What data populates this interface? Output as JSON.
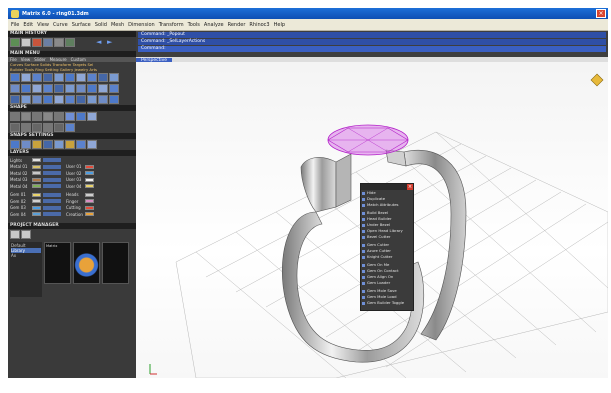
{
  "window": {
    "title": "Matrix 6.0 - ring01.3dm"
  },
  "menu": [
    "File",
    "Edit",
    "View",
    "Curve",
    "Surface",
    "Solid",
    "Mesh",
    "Dimension",
    "Transform",
    "Tools",
    "Analyze",
    "Render",
    "Rhinoc3",
    "Help"
  ],
  "left_panel": {
    "main_history": "MAIN HISTORY",
    "main_menu": "MAIN MENU",
    "main_menu_tabs": [
      "File",
      "View",
      "Slider",
      "Measure",
      "Custom"
    ],
    "builder_row": "Curves Surface Solids Transform Targets Sel",
    "builder_row2": "Builder Tools Ring Setting Gallery Jewelry Arts",
    "shape": "SHAPE",
    "snaps": "SNAPS SETTINGS",
    "layers": "LAYERS",
    "layer_rows": [
      {
        "name": "Lights",
        "right": ""
      },
      {
        "name": "Metal 01",
        "right": "User 01"
      },
      {
        "name": "Metal 02",
        "right": "User 02"
      },
      {
        "name": "Metal 03",
        "right": "User 03"
      },
      {
        "name": "Metal 04",
        "right": "User 04"
      },
      {
        "name": "Gem 01",
        "right": "Heads"
      },
      {
        "name": "Gem 02",
        "right": "Finger"
      },
      {
        "name": "Gem 03",
        "right": "Cutting"
      },
      {
        "name": "Gem 04",
        "right": "Creation"
      }
    ],
    "project_manager": "PROJECT MANAGER",
    "pm_tree": [
      "Default",
      "Library",
      "Ax"
    ],
    "thumb_label": "Matrix"
  },
  "command": {
    "line1": "Command: _Popout",
    "line2": "Command: _SelLayerActions",
    "line3": "Command:"
  },
  "viewport": {
    "label": "Perspective"
  },
  "popup_menu": {
    "groups": [
      [
        "Hide",
        "Duplicate",
        "Match Attributes"
      ],
      [
        "Build Bezel",
        "Head Builder",
        "Under Bezel",
        "Open Head Library",
        "Bezel Cutter"
      ],
      [
        "Gem Cutter",
        "Azure Cutter",
        "Knight Cutter"
      ],
      [
        "Gem On Me",
        "Gem On Contact",
        "Gem Align On",
        "Gem Loader"
      ],
      [
        "Gem Mole Save",
        "Gem Mole Load",
        "Gem Builder Toggle"
      ]
    ]
  },
  "colors": {
    "accent": "#3a5fc2",
    "panel": "#3a3a3a",
    "selection": "#c74be0"
  }
}
